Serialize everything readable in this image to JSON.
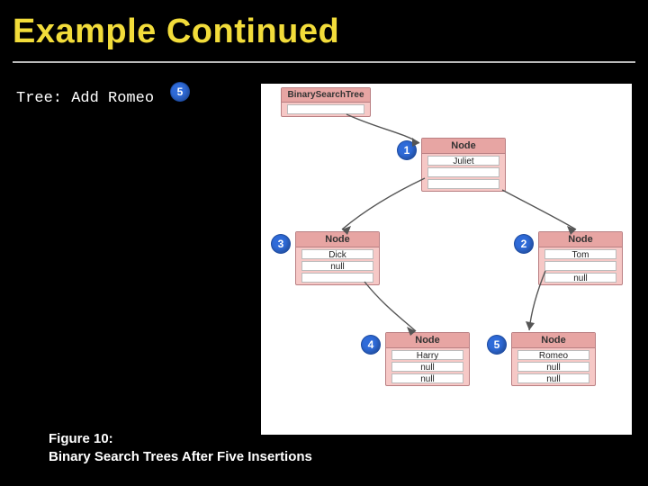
{
  "title": "Example Continued",
  "tree_add_label": "Tree: Add Romeo",
  "callout5": "5",
  "caption_line1": "Figure 10:",
  "caption_line2": "Binary Search Trees After Five Insertions",
  "diagram": {
    "root_header": "BinarySearchTree",
    "node_header": "Node",
    "nodes": {
      "juliet": {
        "value": "Juliet",
        "left": "",
        "right": ""
      },
      "dick": {
        "value": "Dick",
        "left": "null",
        "right": ""
      },
      "tom": {
        "value": "Tom",
        "left": "",
        "right": "null"
      },
      "harry": {
        "value": "Harry",
        "left": "null",
        "right": "null"
      },
      "romeo": {
        "value": "Romeo",
        "left": "null",
        "right": "null"
      }
    },
    "callouts": {
      "c1": "1",
      "c2": "2",
      "c3": "3",
      "c4": "4",
      "c5": "5"
    }
  }
}
